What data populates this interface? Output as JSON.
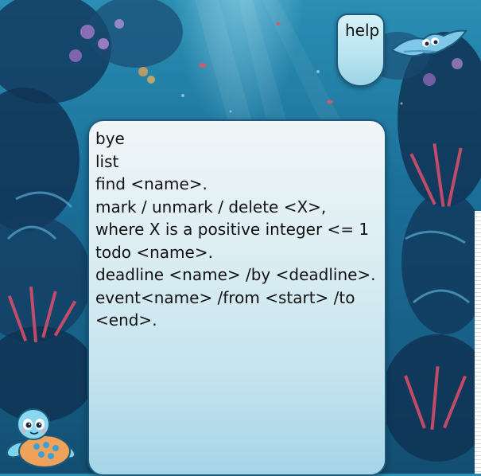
{
  "chat": {
    "user_message": "help",
    "bot_lines": [
      "bye",
      "",
      "list",
      "",
      "find <name>.",
      "",
      "mark / unmark / delete <X>,",
      "where X is a positive integer <= 1",
      "",
      "todo <name>.",
      "",
      "deadline <name> /by <deadline>.",
      "",
      "event<name> /from <start> /to",
      "<end>."
    ]
  },
  "colors": {
    "bubble_border": "#1c5a7c",
    "text": "#111111",
    "background_top": "#2a8fb4",
    "background_bottom": "#124d70"
  },
  "icons": {
    "user_avatar": "manta-ray-icon",
    "bot_avatar": "sea-turtle-icon"
  }
}
